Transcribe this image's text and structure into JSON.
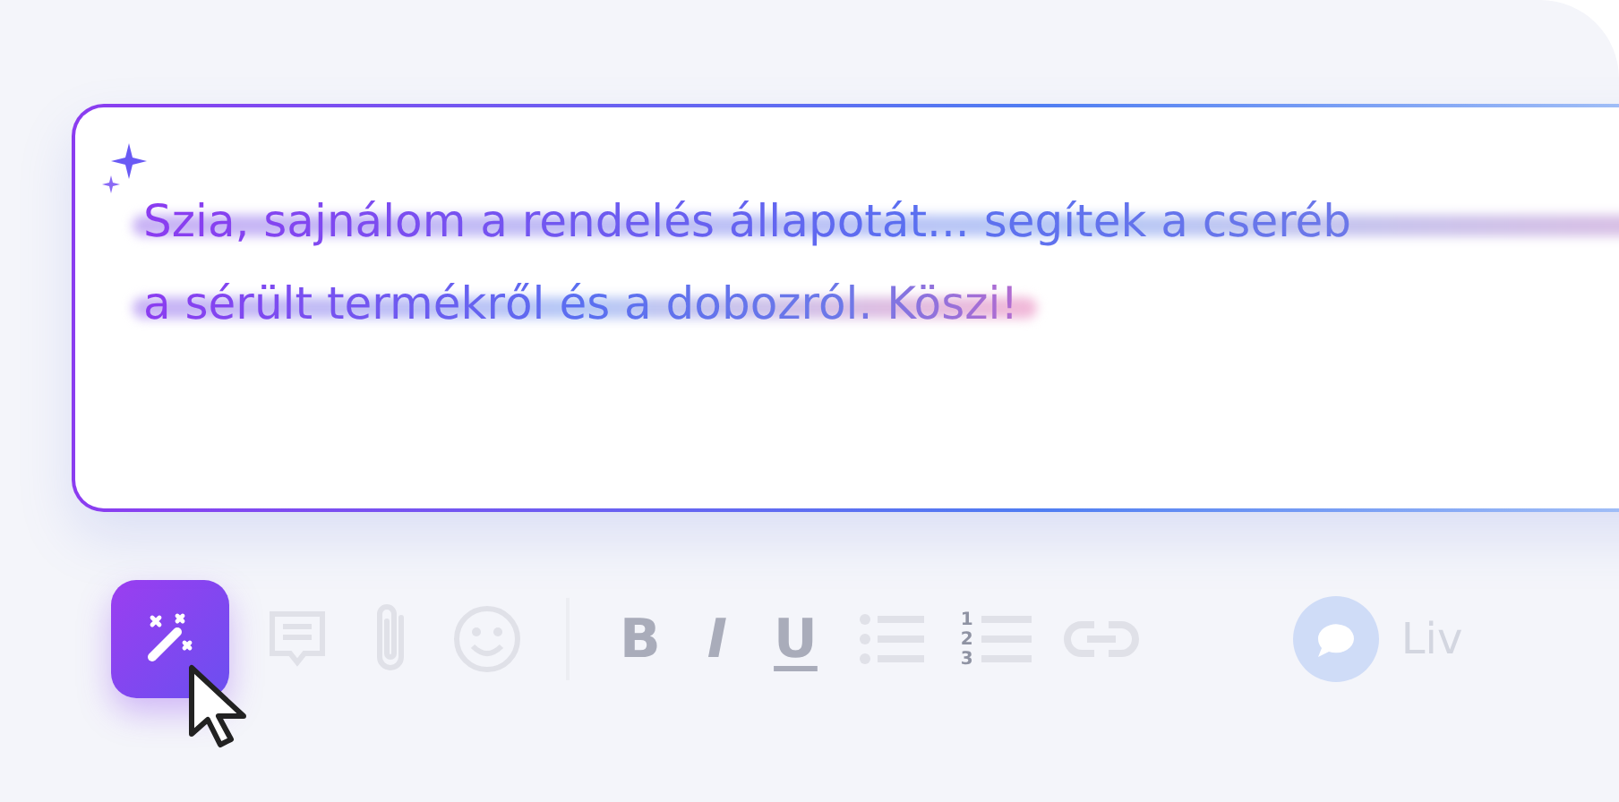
{
  "message": {
    "lines": [
      "Szia, sajnálom a rendelés állapotát... segítek a cseréb",
      "a sérült termékről és a dobozról. Köszi!"
    ]
  },
  "toolbar": [
    {
      "kind": "magic",
      "active": true
    },
    {
      "kind": "comment"
    },
    {
      "kind": "attach"
    },
    {
      "kind": "emoji"
    },
    {
      "kind": "divider"
    },
    {
      "kind": "bold",
      "label": "B"
    },
    {
      "kind": "italic",
      "label": "I"
    },
    {
      "kind": "underline",
      "label": "U"
    },
    {
      "kind": "bullets"
    },
    {
      "kind": "numbers",
      "label": "123"
    },
    {
      "kind": "link"
    }
  ],
  "live_chat": {
    "label": "Liv"
  }
}
